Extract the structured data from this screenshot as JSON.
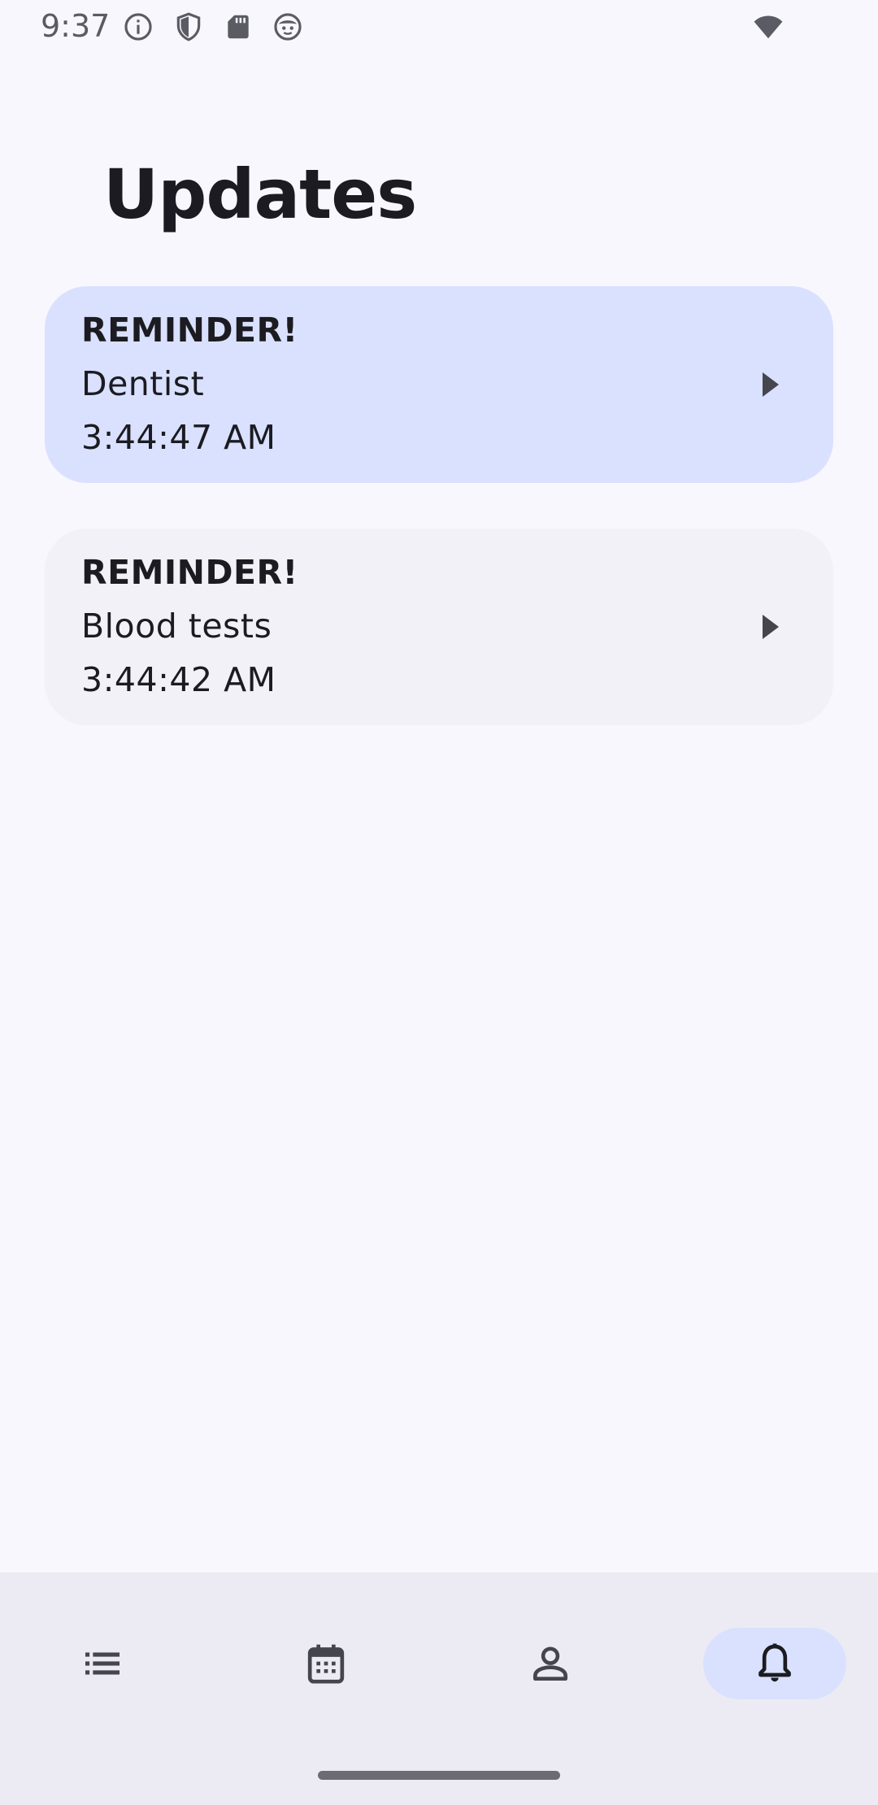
{
  "status_bar": {
    "time": "9:37",
    "icons": [
      "info-icon",
      "shield-icon",
      "sd-card-icon",
      "face-icon",
      "wifi-icon"
    ]
  },
  "page": {
    "title": "Updates"
  },
  "updates": [
    {
      "heading": "REMINDER!",
      "subject": "Dentist",
      "time": "3:44:47 AM",
      "highlighted": true
    },
    {
      "heading": "REMINDER!",
      "subject": "Blood tests",
      "time": "3:44:42 AM",
      "highlighted": false
    }
  ],
  "bottom_nav": {
    "items": [
      {
        "icon": "list-icon",
        "selected": false
      },
      {
        "icon": "calendar-icon",
        "selected": false
      },
      {
        "icon": "person-icon",
        "selected": false
      },
      {
        "icon": "bell-icon",
        "selected": true
      }
    ]
  },
  "colors": {
    "background": "#F8F7FD",
    "active_card": "#DAE1FE",
    "inactive_card": "#F1F1F7",
    "nav_background": "#ECEBF3",
    "nav_selected": "#DAE1FE",
    "text": "#1B1B21"
  }
}
